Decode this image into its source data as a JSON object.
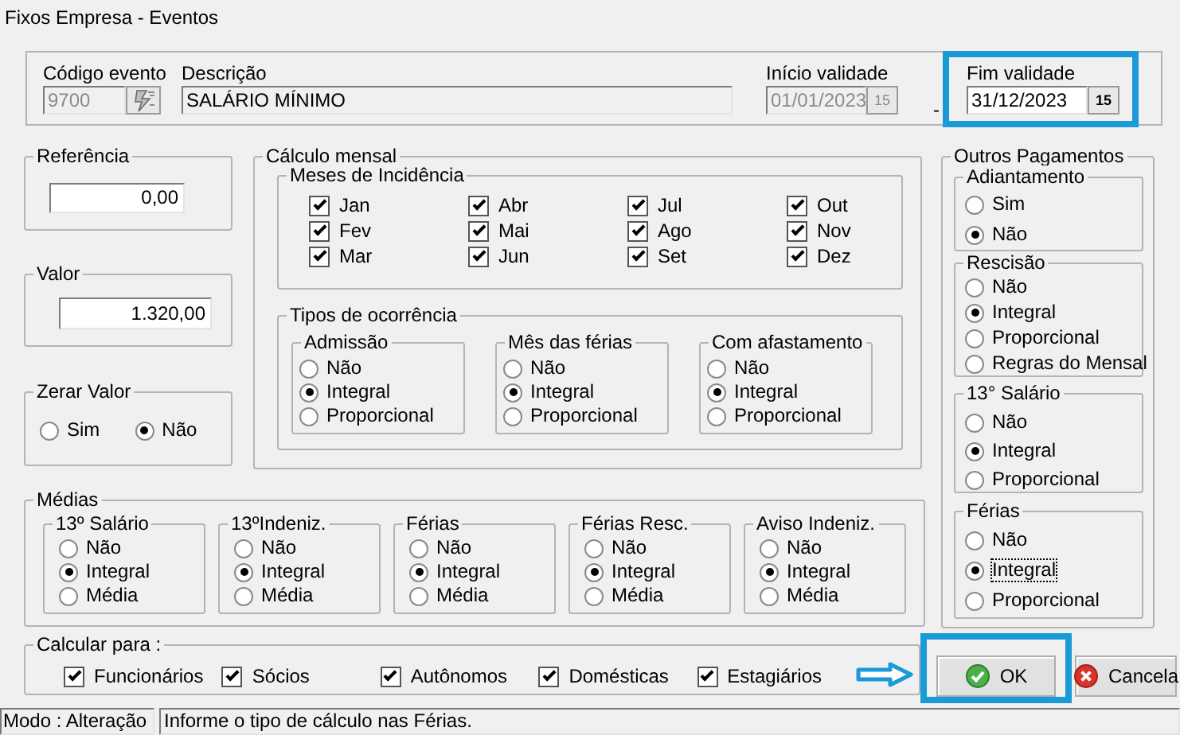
{
  "window": {
    "title": "Fixos Empresa - Eventos"
  },
  "header": {
    "separator": "-",
    "fields": [
      {
        "kind": "lookup",
        "label": "Código  evento",
        "value": "9700",
        "disabled": true,
        "readonly": false,
        "highlighted": false
      },
      {
        "kind": "text",
        "label": "Descrição",
        "value": "SALÁRIO MÍNIMO",
        "disabled": false,
        "readonly": true,
        "highlighted": false
      },
      {
        "kind": "date",
        "label": "Início validade",
        "value": "01/01/2023",
        "button_text": "15",
        "disabled": true,
        "readonly": false,
        "highlighted": false
      },
      {
        "kind": "date",
        "label": "Fim validade",
        "value": "31/12/2023",
        "button_text": "15",
        "disabled": false,
        "readonly": false,
        "highlighted": true
      }
    ]
  },
  "referencia": {
    "title": "Referência",
    "value": "0,00"
  },
  "valor": {
    "title": "Valor",
    "value": "1.320,00"
  },
  "zerar_valor": {
    "title": "Zerar Valor",
    "options": [
      {
        "label": "Sim",
        "selected": false
      },
      {
        "label": "Não",
        "selected": true
      }
    ]
  },
  "calculo_mensal": {
    "title": "Cálculo mensal",
    "meses": {
      "title": "Meses de Incidência",
      "items": [
        {
          "label": "Jan",
          "checked": true
        },
        {
          "label": "Fev",
          "checked": true
        },
        {
          "label": "Mar",
          "checked": true
        },
        {
          "label": "Abr",
          "checked": true
        },
        {
          "label": "Mai",
          "checked": true
        },
        {
          "label": "Jun",
          "checked": true
        },
        {
          "label": "Jul",
          "checked": true
        },
        {
          "label": "Ago",
          "checked": true
        },
        {
          "label": "Set",
          "checked": true
        },
        {
          "label": "Out",
          "checked": true
        },
        {
          "label": "Nov",
          "checked": true
        },
        {
          "label": "Dez",
          "checked": true
        }
      ]
    },
    "tipos": {
      "title": "Tipos de ocorrência",
      "groups": [
        {
          "title": "Admissão",
          "options": [
            {
              "label": "Não",
              "selected": false
            },
            {
              "label": "Integral",
              "selected": true
            },
            {
              "label": "Proporcional",
              "selected": false
            }
          ]
        },
        {
          "title": "Mês das férias",
          "options": [
            {
              "label": "Não",
              "selected": false
            },
            {
              "label": "Integral",
              "selected": true
            },
            {
              "label": "Proporcional",
              "selected": false
            }
          ]
        },
        {
          "title": "Com afastamento",
          "options": [
            {
              "label": "Não",
              "selected": false
            },
            {
              "label": "Integral",
              "selected": true
            },
            {
              "label": "Proporcional",
              "selected": false
            }
          ]
        }
      ]
    }
  },
  "outros_pagamentos": {
    "title": "Outros Pagamentos",
    "groups": [
      {
        "title": "Adiantamento",
        "options": [
          {
            "label": "Sim",
            "selected": false
          },
          {
            "label": "Não",
            "selected": true
          }
        ]
      },
      {
        "title": "Rescisão",
        "options": [
          {
            "label": "Não",
            "selected": false
          },
          {
            "label": "Integral",
            "selected": true
          },
          {
            "label": "Proporcional",
            "selected": false
          },
          {
            "label": "Regras do Mensal",
            "selected": false
          }
        ]
      },
      {
        "title": "13° Salário",
        "options": [
          {
            "label": "Não",
            "selected": false
          },
          {
            "label": "Integral",
            "selected": true
          },
          {
            "label": "Proporcional",
            "selected": false
          }
        ]
      },
      {
        "title": "Férias",
        "options": [
          {
            "label": "Não",
            "selected": false,
            "focused": false
          },
          {
            "label": "Integral",
            "selected": true,
            "focused": true
          },
          {
            "label": "Proporcional",
            "selected": false,
            "focused": false
          }
        ]
      }
    ]
  },
  "medias": {
    "title": "Médias",
    "groups": [
      {
        "title": "13º Salário",
        "options": [
          {
            "label": "Não",
            "selected": false
          },
          {
            "label": "Integral",
            "selected": true
          },
          {
            "label": "Média",
            "selected": false
          }
        ]
      },
      {
        "title": "13ºIndeniz.",
        "options": [
          {
            "label": "Não",
            "selected": false
          },
          {
            "label": "Integral",
            "selected": true
          },
          {
            "label": "Média",
            "selected": false
          }
        ]
      },
      {
        "title": "Férias",
        "options": [
          {
            "label": "Não",
            "selected": false
          },
          {
            "label": "Integral",
            "selected": true
          },
          {
            "label": "Média",
            "selected": false
          }
        ]
      },
      {
        "title": "Férias Resc.",
        "options": [
          {
            "label": "Não",
            "selected": false
          },
          {
            "label": "Integral",
            "selected": true
          },
          {
            "label": "Média",
            "selected": false
          }
        ]
      },
      {
        "title": "Aviso Indeniz.",
        "options": [
          {
            "label": "Não",
            "selected": false
          },
          {
            "label": "Integral",
            "selected": true
          },
          {
            "label": "Média",
            "selected": false
          }
        ]
      }
    ]
  },
  "calcular_para": {
    "title": "Calcular para :",
    "items": [
      {
        "label": "Funcionários",
        "checked": true
      },
      {
        "label": "Sócios",
        "checked": true
      },
      {
        "label": "Autônomos",
        "checked": true
      },
      {
        "label": "Domésticas",
        "checked": true
      },
      {
        "label": "Estagiários",
        "checked": true
      }
    ]
  },
  "buttons": [
    {
      "kind": "ok",
      "label": "OK",
      "highlighted": true
    },
    {
      "kind": "cancel",
      "label": "Cancela",
      "highlighted": false
    }
  ],
  "status_bar": {
    "mode": "Modo : Alteração",
    "message": "Informe o tipo de cálculo nas Férias."
  }
}
